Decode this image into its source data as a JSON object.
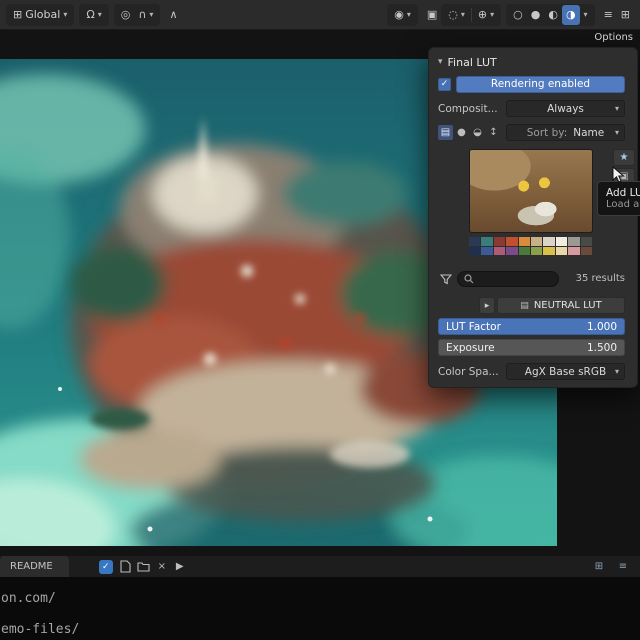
{
  "topbar": {
    "orientation": "Global",
    "options_label": "Options"
  },
  "panel": {
    "title": "Final LUT",
    "rendering_button_label": "Rendering enabled",
    "composite": {
      "label": "Composit...",
      "value": "Always"
    },
    "sort": {
      "label": "Sort by:",
      "value": "Name"
    },
    "asset": {
      "results_label": "35 results",
      "palette": [
        "#2b3a52",
        "#3a7d7d",
        "#8a3a2e",
        "#c0502e",
        "#d98a3a",
        "#c8b089",
        "#d8d4c8",
        "#f0ece0",
        "#9a9a92",
        "#4a4a46",
        "#1f2f4f",
        "#3a5a9a",
        "#b05a7a",
        "#7a4a8a",
        "#4a7a3a",
        "#8aa04a",
        "#d8c04a",
        "#e8d8a8",
        "#d89aa0",
        "#6a4a3a"
      ]
    },
    "lut_button_label": "NEUTRAL LUT",
    "lut_factor": {
      "label": "LUT Factor",
      "value": "1.000"
    },
    "exposure": {
      "label": "Exposure",
      "value": "1.500"
    },
    "colorspace": {
      "label": "Color Spa...",
      "value": "AgX Base sRGB"
    }
  },
  "tooltip": {
    "title": "Add LUT",
    "subtitle": "Load a ne"
  },
  "editor": {
    "tab_label": "README"
  },
  "console": {
    "line1": "on.com/",
    "line2": "emo-files/"
  },
  "colors": {
    "accent_blue": "#4772b3",
    "slider_gray": "#565656"
  },
  "icons": {
    "orientation": "⊞",
    "arrow_down": "▾",
    "magnet": "Ω",
    "proportional": "◎",
    "falloff": "∩",
    "tool": "∧",
    "visibility": "◉",
    "xray": "▣",
    "overlays": "◌",
    "gizmos": "⊕",
    "wireframe": "○",
    "solid": "●",
    "material": "◐",
    "rendered": "◑",
    "menu": "≡",
    "grid": "⊞",
    "expand": "▸",
    "check": "✓",
    "close": "×",
    "play": "▶",
    "star": "★",
    "clipboard": "▣",
    "image_view": "▤",
    "sphere_view": "●",
    "half_view": "◒",
    "sort_dir": "↕",
    "collapse": "▾",
    "lut_icon": "▤"
  }
}
